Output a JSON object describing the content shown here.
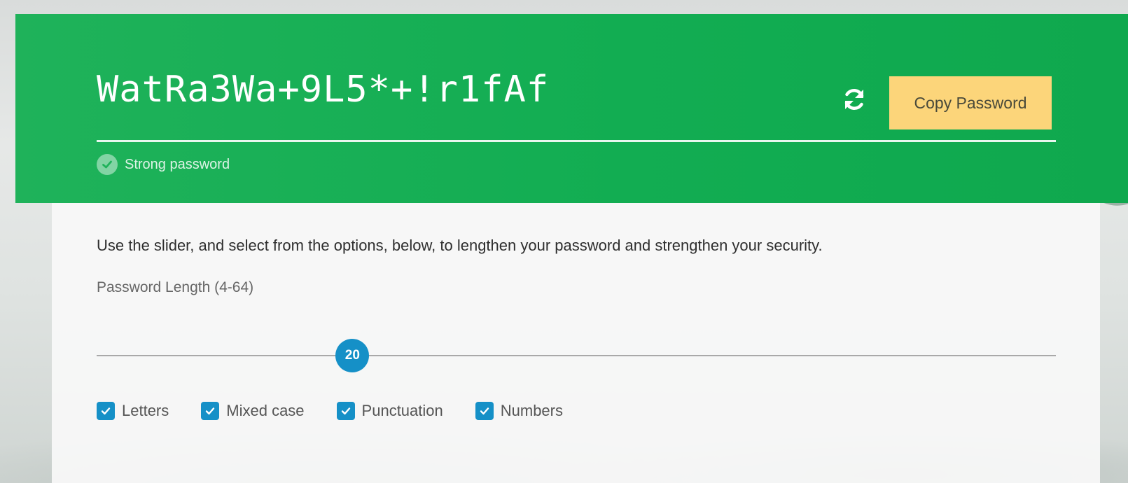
{
  "colors": {
    "header_green": "#12ad52",
    "copy_button_bg": "#fcd57a",
    "accent_blue": "#1590c7"
  },
  "header": {
    "password": "WatRa3Wa+9L5*+!r1fAf",
    "refresh_icon": "refresh-icon",
    "copy_label": "Copy Password",
    "strength_icon": "check-circle-icon",
    "strength_label": "Strong password"
  },
  "settings": {
    "instructions": "Use the slider, and select from the options, below, to lengthen your password and strengthen your security.",
    "length_label": "Password Length (4-64)",
    "length": {
      "min": 4,
      "max": 64,
      "value": 20,
      "value_label": "20"
    },
    "options": [
      {
        "label": "Letters",
        "checked": true
      },
      {
        "label": "Mixed case",
        "checked": true
      },
      {
        "label": "Punctuation",
        "checked": true
      },
      {
        "label": "Numbers",
        "checked": true
      }
    ]
  }
}
